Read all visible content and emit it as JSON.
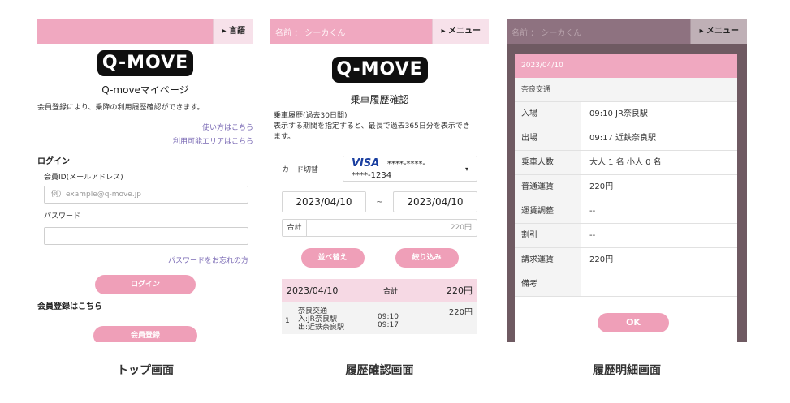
{
  "captions": {
    "top": "トップ画面",
    "history": "履歴確認画面",
    "detail": "履歴明細画面"
  },
  "top_screen": {
    "menu": "▸ 言語",
    "logo": "Q-MOVE",
    "title": "Q-moveマイページ",
    "description": "会員登録により、乗降の利用履歴確認ができます。",
    "link_howto": "使い方はこちら",
    "link_area": "利用可能エリアはこちら",
    "login_heading": "ログイン",
    "member_id_label": "会員ID(メールアドレス)",
    "member_id_placeholder": "例）example@q-move.jp",
    "password_label": "パスワード",
    "forgot_password": "パスワードをお忘れの方",
    "login_button": "ログイン",
    "register_heading": "会員登録はこちら",
    "register_button": "会員登録"
  },
  "history_screen": {
    "name": "名前 ： シーカくん",
    "menu": "▸ メニュー",
    "logo": "Q-MOVE",
    "title": "乗車履歴確認",
    "description_1": "乗車履歴(過去30日間)",
    "description_2": "表示する期間を指定すると、最長で過去365日分を表示でき",
    "description_3": "ます。",
    "card_label": "カード切替",
    "card_brand": "VISA",
    "card_number": "****-****-****-1234",
    "date_from": "2023/04/10",
    "date_tilde": "~",
    "date_to": "2023/04/10",
    "total_label": "合計",
    "total_value": "220円",
    "sort_button": "並べ替え",
    "filter_button": "絞り込み",
    "list_header": {
      "date": "2023/04/10",
      "total_label": "合計",
      "total": "220円"
    },
    "items": [
      {
        "num": "1",
        "company": "奈良交通",
        "entry": "入:JR奈良駅",
        "entry_time": "09:10",
        "exit": "出:近鉄奈良駅",
        "exit_time": "09:17",
        "amount": "220円"
      }
    ]
  },
  "detail_screen": {
    "name": "名前 ： シーカくん",
    "menu": "▸ メニュー",
    "date": "2023/04/10",
    "company": "奈良交通",
    "rows": [
      {
        "key": "入場",
        "value": "09:10  JR奈良駅"
      },
      {
        "key": "出場",
        "value": "09:17  近鉄奈良駅"
      },
      {
        "key": "乗車人数",
        "value": "大人 1 名  小人 0 名"
      },
      {
        "key": "普通運賃",
        "value": "220円"
      },
      {
        "key": "運賃調整",
        "value": "--"
      },
      {
        "key": "割引",
        "value": "--"
      },
      {
        "key": "請求運賃",
        "value": "220円"
      },
      {
        "key": "備考",
        "value": ""
      }
    ],
    "ok_button": "OK"
  }
}
